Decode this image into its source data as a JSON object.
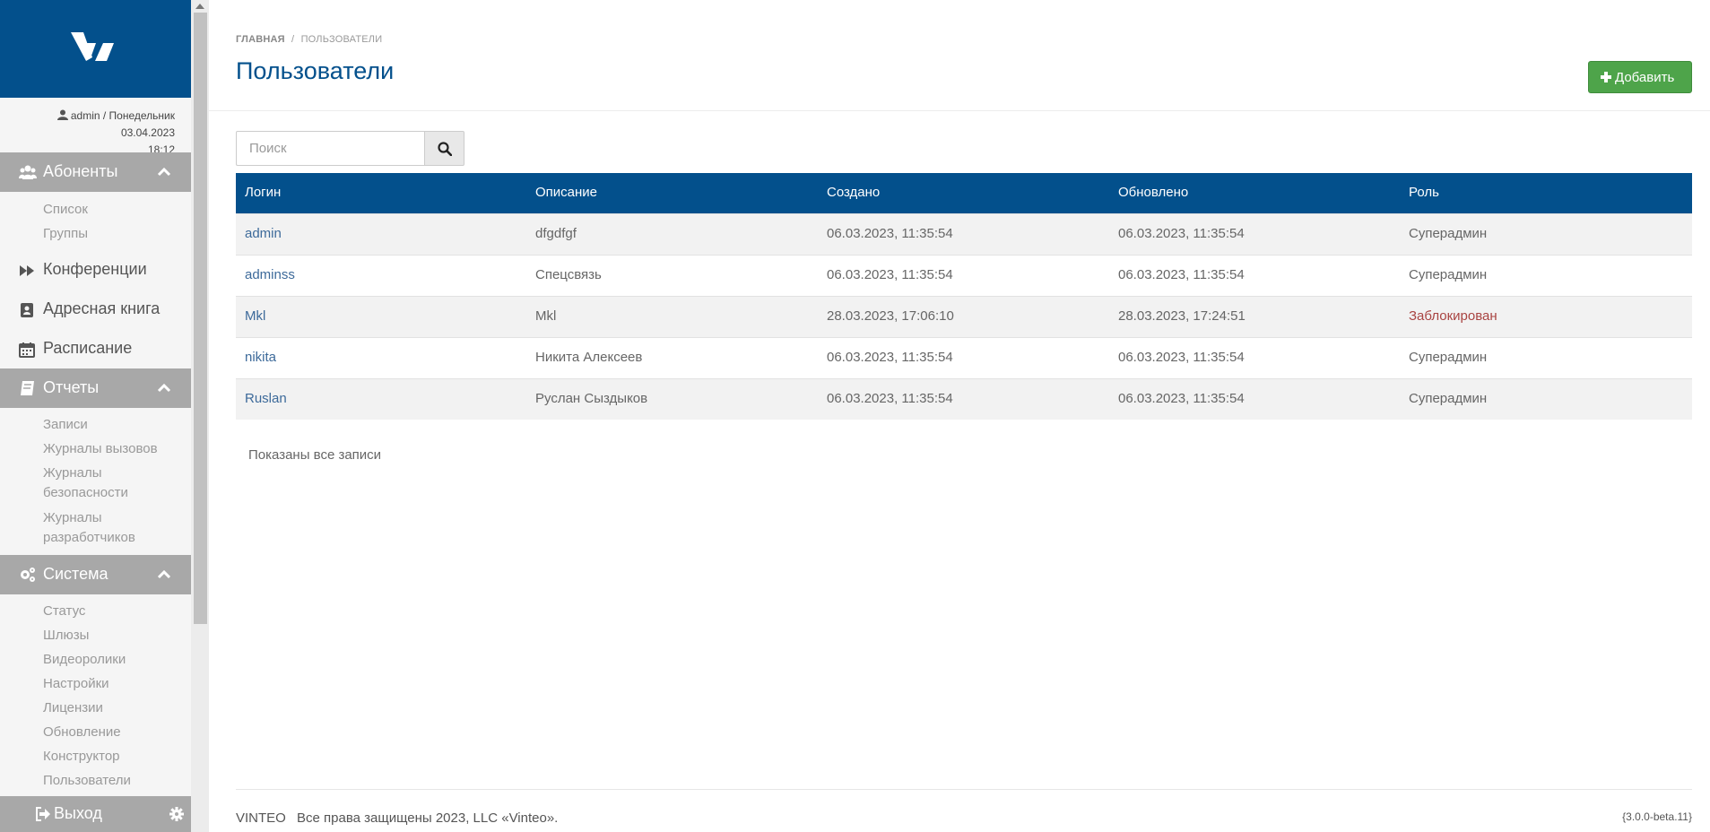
{
  "brand_color": "#03508c",
  "user_info": {
    "line1": "admin / Понедельник 03.04.2023",
    "line2": "18:12"
  },
  "sidebar": {
    "subscribers": {
      "label": "Абоненты",
      "icon": "users-icon",
      "items": [
        "Список",
        "Группы"
      ]
    },
    "conferences": {
      "label": "Конференции",
      "icon": "fast-forward-icon"
    },
    "address_book": {
      "label": "Адресная книга",
      "icon": "address-book-icon"
    },
    "schedule": {
      "label": "Расписание",
      "icon": "calendar-icon"
    },
    "reports": {
      "label": "Отчеты",
      "icon": "book-icon",
      "items": [
        "Записи",
        "Журналы вызовов",
        "Журналы безопасности",
        "Журналы разработчиков"
      ]
    },
    "system": {
      "label": "Система",
      "icon": "gears-icon",
      "items": [
        "Статус",
        "Шлюзы",
        "Видеоролики",
        "Настройки",
        "Лицензии",
        "Обновление",
        "Конструктор",
        "Пользователи"
      ]
    },
    "logout": {
      "label": "Выход",
      "icon": "sign-out-icon"
    }
  },
  "breadcrumb": {
    "home": "ГЛАВНАЯ",
    "separator": "/",
    "current": "ПОЛЬЗОВАТЕЛИ"
  },
  "page_title": "Пользователи",
  "add_button_label": "Добавить",
  "search": {
    "placeholder": "Поиск"
  },
  "table": {
    "columns": [
      "Логин",
      "Описание",
      "Создано",
      "Обновлено",
      "Роль"
    ],
    "rows": [
      {
        "login": "admin",
        "description": "dfgdfgf",
        "created": "06.03.2023, 11:35:54",
        "updated": "06.03.2023, 11:35:54",
        "role": "Суперадмин",
        "blocked": false
      },
      {
        "login": "adminss",
        "description": "Спецсвязь",
        "created": "06.03.2023, 11:35:54",
        "updated": "06.03.2023, 11:35:54",
        "role": "Суперадмин",
        "blocked": false
      },
      {
        "login": "Mkl",
        "description": "Mkl",
        "created": "28.03.2023, 17:06:10",
        "updated": "28.03.2023, 17:24:51",
        "role": "Заблокирован",
        "blocked": true
      },
      {
        "login": "nikita",
        "description": "Никита Алексеев",
        "created": "06.03.2023, 11:35:54",
        "updated": "06.03.2023, 11:35:54",
        "role": "Суперадмин",
        "blocked": false
      },
      {
        "login": "Ruslan",
        "description": "Руслан Сыздыков",
        "created": "06.03.2023, 11:35:54",
        "updated": "06.03.2023, 11:35:54",
        "role": "Суперадмин",
        "blocked": false
      }
    ]
  },
  "shown_note": "Показаны все записи",
  "footer": {
    "brand": "VINTEO",
    "copyright": "Все права защищены 2023, LLC «Vinteo»."
  },
  "version": "{3.0.0-beta.11}"
}
